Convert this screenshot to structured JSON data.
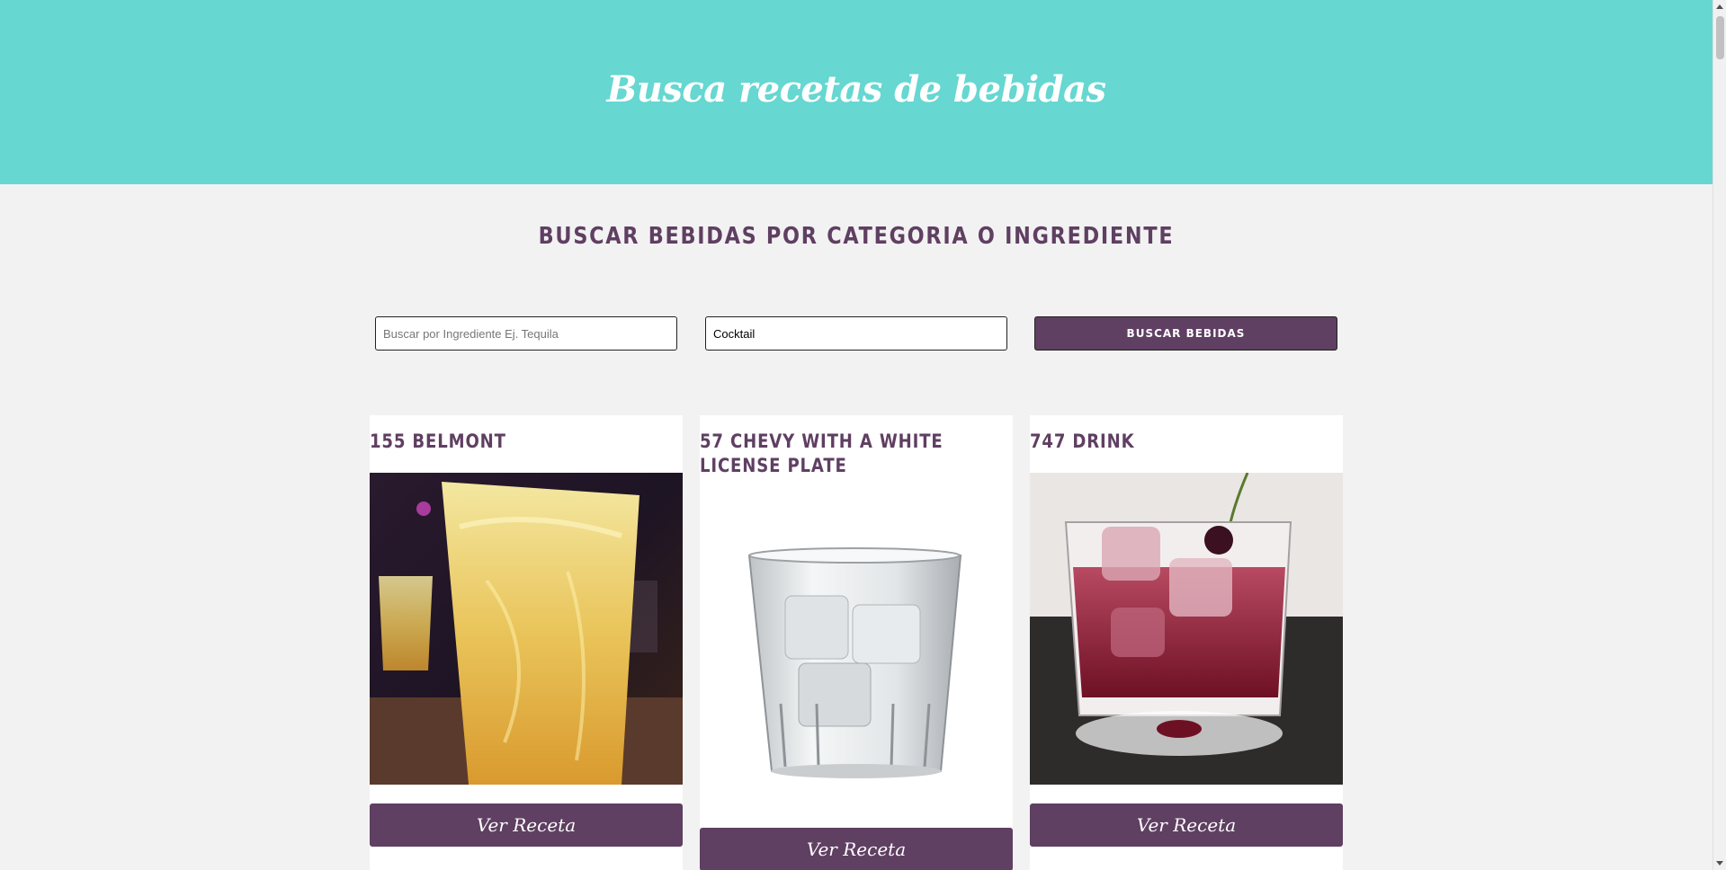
{
  "header": {
    "title": "Busca recetas de bebidas"
  },
  "search": {
    "heading": "Buscar bebidas por categoria o ingrediente",
    "ingredient_placeholder": "Buscar por Ingrediente Ej. Tequila",
    "ingredient_value": "",
    "category_value": "Cocktail",
    "button_label": "Buscar Bebidas"
  },
  "drinks": [
    {
      "name": "155 Belmont",
      "button_label": "Ver Receta",
      "image": "orange-cocktail-photo"
    },
    {
      "name": "57 Chevy with a White License Plate",
      "button_label": "Ver Receta",
      "image": "clear-rocks-glass-photo"
    },
    {
      "name": "747 Drink",
      "button_label": "Ver Receta",
      "image": "red-cocktail-with-cherry-photo"
    }
  ],
  "colors": {
    "header_bg": "#66d7d1",
    "accent_purple": "#5f3f62",
    "page_bg": "#f2f2f2",
    "card_bg": "#ffffff"
  }
}
